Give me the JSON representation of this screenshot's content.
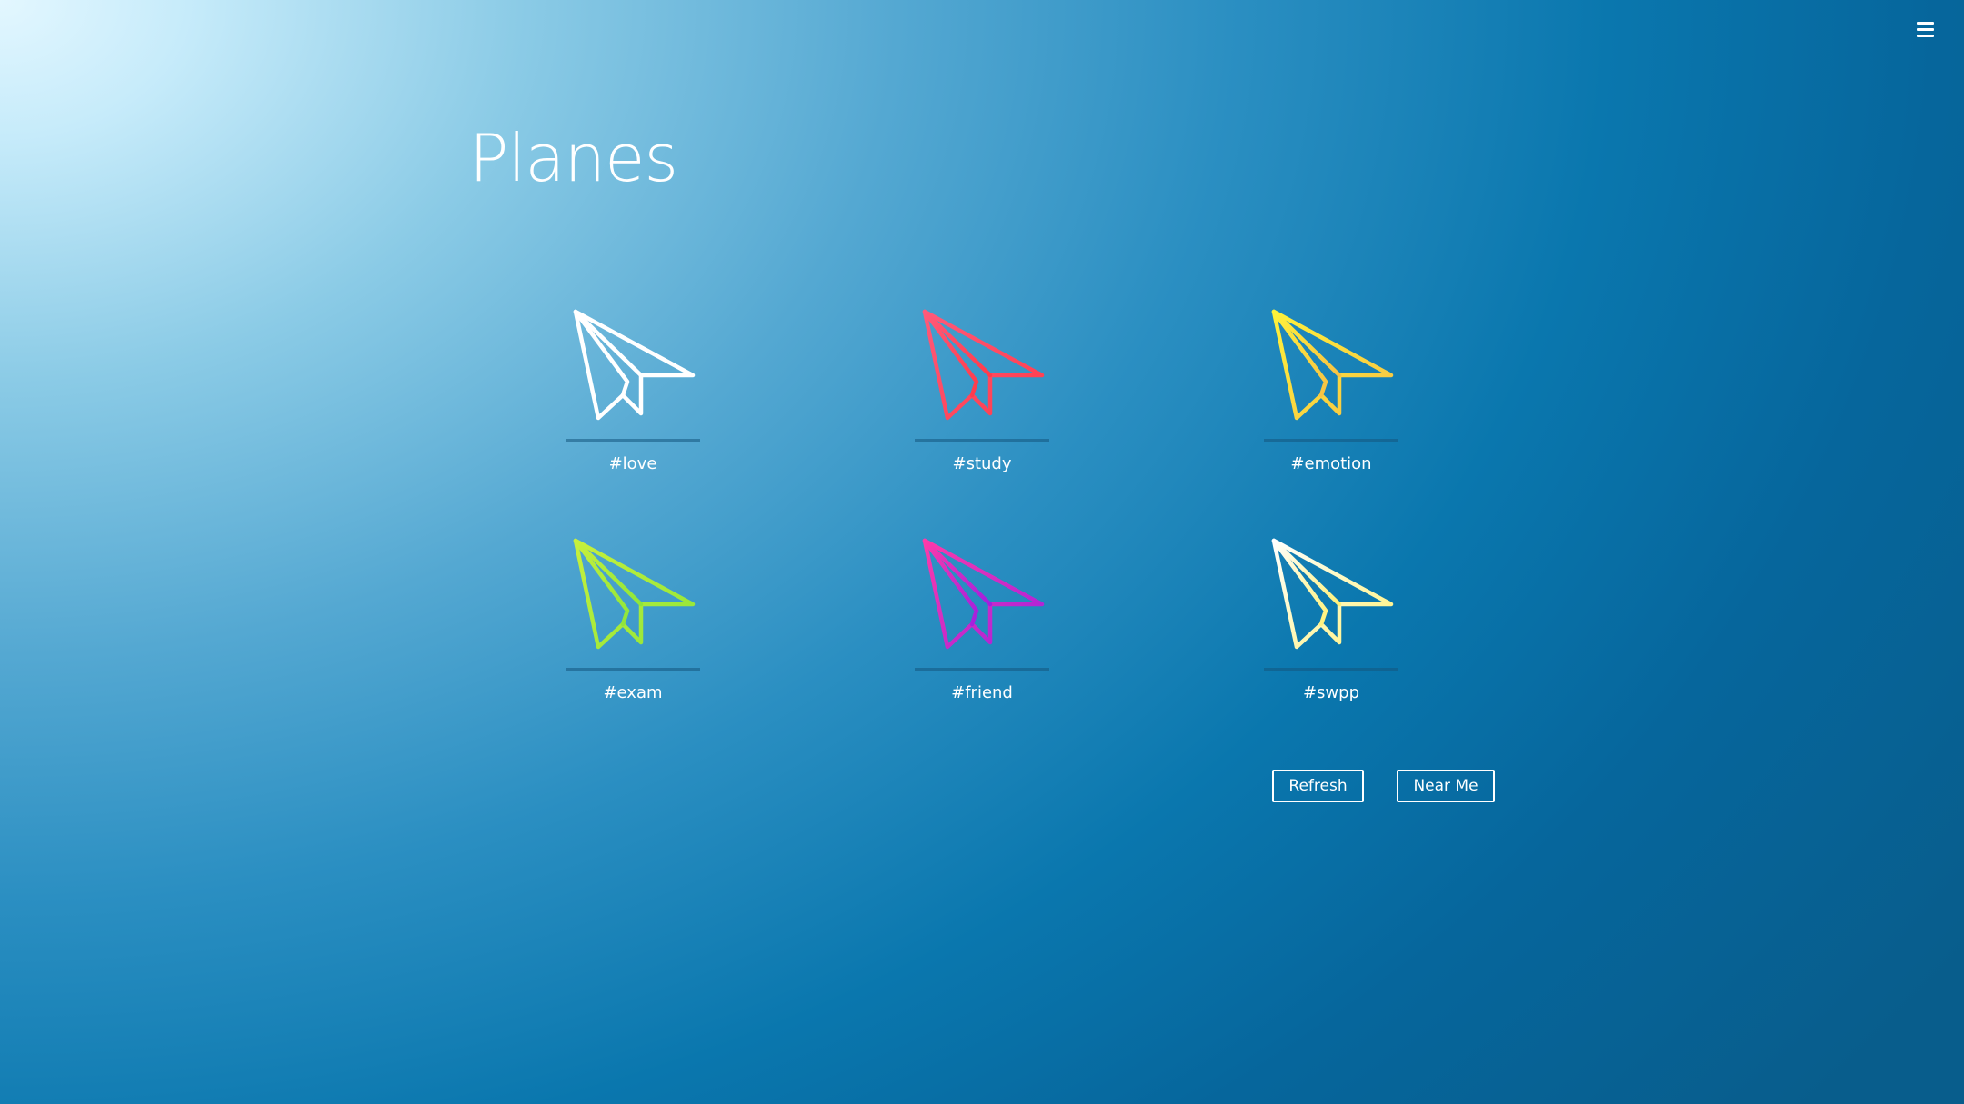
{
  "page": {
    "title": "Planes",
    "menu_icon": "hamburger-menu-icon"
  },
  "planes": [
    {
      "tag": "#love",
      "icon": "paper-plane-icon",
      "colors": [
        "#ffffff",
        "#ffffff"
      ]
    },
    {
      "tag": "#study",
      "icon": "paper-plane-icon",
      "colors": [
        "#ff5a7a",
        "#ff3b4a"
      ]
    },
    {
      "tag": "#emotion",
      "icon": "paper-plane-icon",
      "colors": [
        "#fff23a",
        "#f7c244"
      ]
    },
    {
      "tag": "#exam",
      "icon": "paper-plane-icon",
      "colors": [
        "#c8f03c",
        "#8ee63a"
      ]
    },
    {
      "tag": "#friend",
      "icon": "paper-plane-icon",
      "colors": [
        "#ff3aa8",
        "#a020e0"
      ]
    },
    {
      "tag": "#swpp",
      "icon": "paper-plane-icon",
      "colors": [
        "#ffffff",
        "#fff27a"
      ]
    }
  ],
  "actions": {
    "refresh_label": "Refresh",
    "near_me_label": "Near Me"
  }
}
